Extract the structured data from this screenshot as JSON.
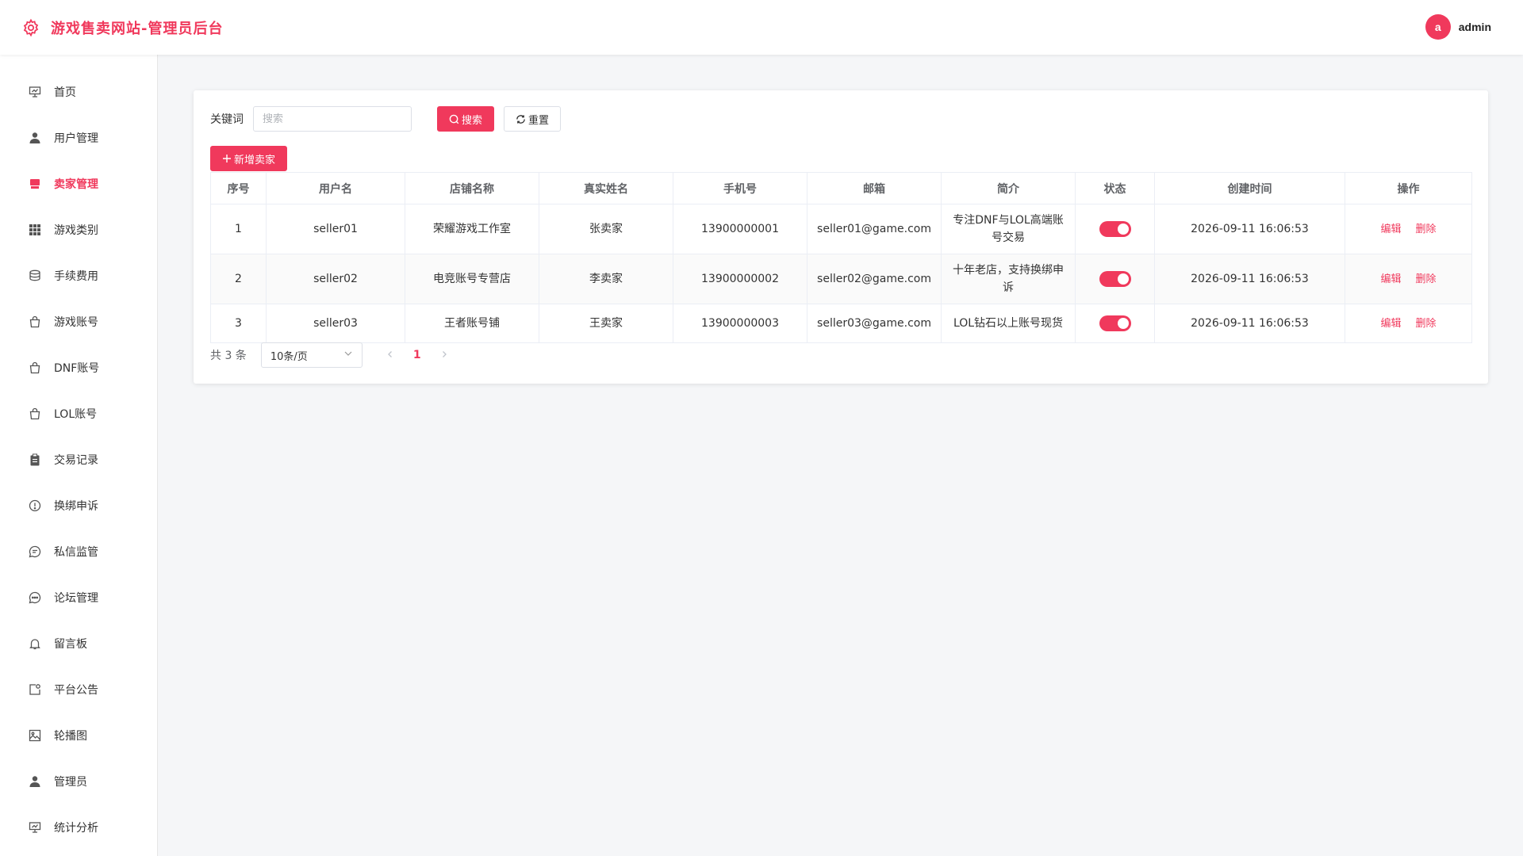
{
  "header": {
    "title": "游戏售卖网站-管理员后台",
    "logo_icon": "gear-icon",
    "avatar_letter": "a",
    "username": "admin"
  },
  "sidebar": {
    "items": [
      {
        "label": "首页",
        "icon": "presentation-icon"
      },
      {
        "label": "用户管理",
        "icon": "user-icon"
      },
      {
        "label": "卖家管理",
        "icon": "shop-icon",
        "active": true
      },
      {
        "label": "游戏类别",
        "icon": "grid-icon"
      },
      {
        "label": "手续费用",
        "icon": "coins-icon"
      },
      {
        "label": "游戏账号",
        "icon": "bag-icon"
      },
      {
        "label": "DNF账号",
        "icon": "bag-icon"
      },
      {
        "label": "LOL账号",
        "icon": "bag-icon"
      },
      {
        "label": "交易记录",
        "icon": "clipboard-icon"
      },
      {
        "label": "换绑申诉",
        "icon": "warning-circle-icon"
      },
      {
        "label": "私信监管",
        "icon": "message-icon"
      },
      {
        "label": "论坛管理",
        "icon": "chat-dots-icon"
      },
      {
        "label": "留言板",
        "icon": "bell-icon"
      },
      {
        "label": "平台公告",
        "icon": "notice-icon"
      },
      {
        "label": "轮播图",
        "icon": "picture-icon"
      },
      {
        "label": "管理员",
        "icon": "user-icon"
      },
      {
        "label": "统计分析",
        "icon": "presentation-icon"
      }
    ]
  },
  "toolbar": {
    "keyword_label": "关键词",
    "search_placeholder": "搜索",
    "search_label": "搜索",
    "reset_label": "重置",
    "add_label": "新增卖家"
  },
  "table": {
    "columns": [
      "序号",
      "用户名",
      "店铺名称",
      "真实姓名",
      "手机号",
      "邮箱",
      "简介",
      "状态",
      "创建时间",
      "操作"
    ],
    "rows": [
      {
        "no": "1",
        "username": "seller01",
        "shop": "荣耀游戏工作室",
        "real_name": "张卖家",
        "phone": "13900000001",
        "email": "seller01@game.com",
        "intro": "专注DNF与LOL高端账号交易",
        "status": true,
        "created": "2026-09-11 16:06:53"
      },
      {
        "no": "2",
        "username": "seller02",
        "shop": "电竞账号专营店",
        "real_name": "李卖家",
        "phone": "13900000002",
        "email": "seller02@game.com",
        "intro": "十年老店，支持换绑申诉",
        "status": true,
        "created": "2026-09-11 16:06:53"
      },
      {
        "no": "3",
        "username": "seller03",
        "shop": "王者账号铺",
        "real_name": "王卖家",
        "phone": "13900000003",
        "email": "seller03@game.com",
        "intro": "LOL钻石以上账号现货",
        "status": true,
        "created": "2026-09-11 16:06:53"
      }
    ],
    "edit_label": "编辑",
    "delete_label": "删除"
  },
  "pagination": {
    "total_text": "共 3 条",
    "page_size": "10条/页",
    "current_page": "1"
  },
  "colors": {
    "accent": "#f0395c"
  }
}
